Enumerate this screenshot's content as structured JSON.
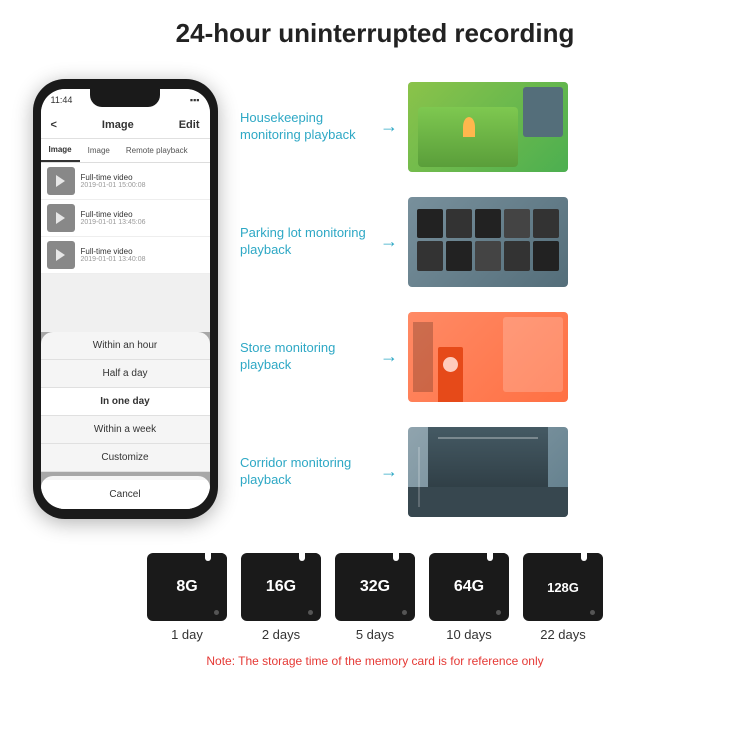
{
  "header": {
    "title": "24-hour uninterrupted recording"
  },
  "phone": {
    "status_time": "11:44",
    "nav_back": "<",
    "nav_title": "Image",
    "nav_edit": "Edit",
    "tabs": [
      "Image",
      "Image",
      "Remote playback"
    ],
    "list_items": [
      {
        "label": "Full-time video",
        "date": "2019-01-01 15:00:08"
      },
      {
        "label": "Full-time video",
        "date": "2019-01-01 13:45:06"
      },
      {
        "label": "Full-time video",
        "date": "2019-01-01 13:40:08"
      }
    ],
    "dropdown_items": [
      "Within an hour",
      "Half a day",
      "In one day",
      "Within a week",
      "Customize"
    ],
    "cancel_label": "Cancel"
  },
  "monitoring": {
    "items": [
      {
        "label": "Housekeeping monitoring playback"
      },
      {
        "label": "Parking lot monitoring playback"
      },
      {
        "label": "Store monitoring playback"
      },
      {
        "label": "Corridor monitoring playback"
      }
    ]
  },
  "storage": {
    "cards": [
      {
        "size": "8G",
        "days": "1 day"
      },
      {
        "size": "16G",
        "days": "2 days"
      },
      {
        "size": "32G",
        "days": "5 days"
      },
      {
        "size": "64G",
        "days": "10 days"
      },
      {
        "size": "128G",
        "days": "22 days"
      }
    ],
    "note": "Note: The storage time of the memory card is for reference only"
  }
}
